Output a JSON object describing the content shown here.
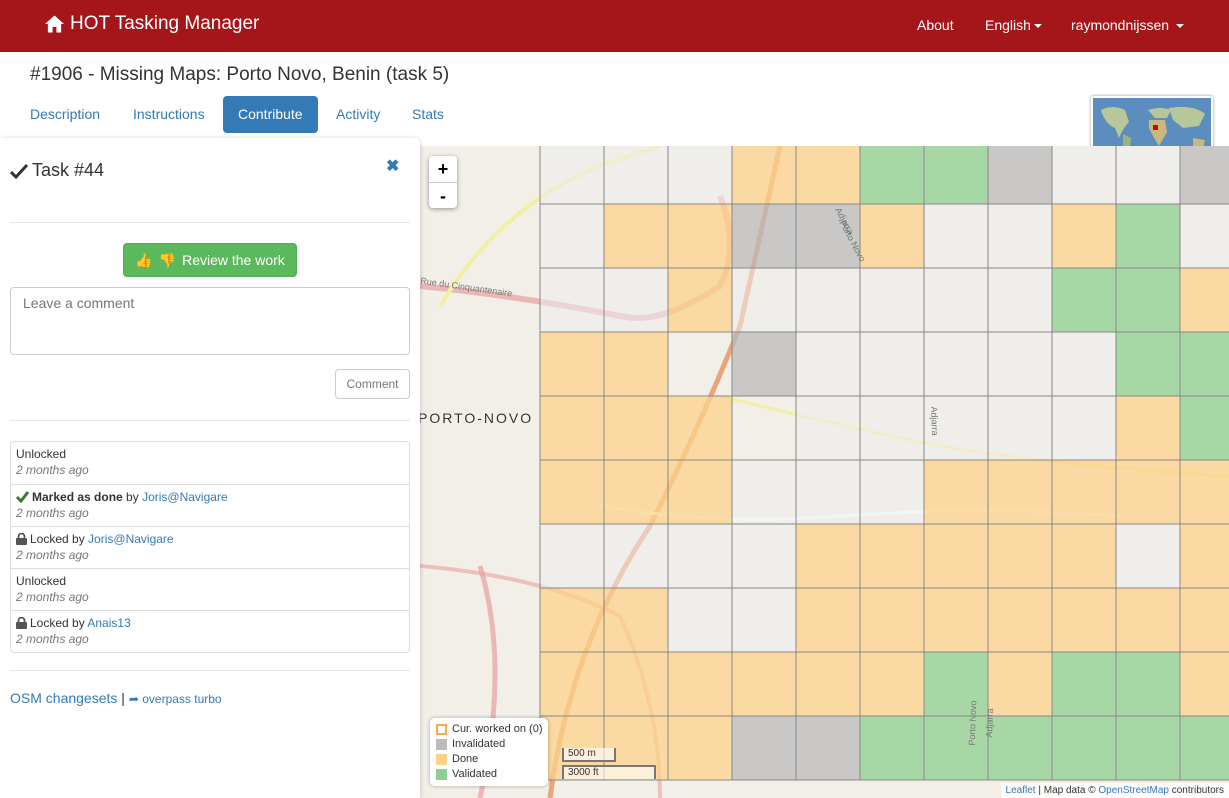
{
  "navbar": {
    "brand": "HOT Tasking Manager",
    "about": "About",
    "language": "English",
    "user": "raymondnijssen"
  },
  "project": {
    "title": "#1906 - Missing Maps: Porto Novo, Benin (task 5)"
  },
  "tabs": [
    "Description",
    "Instructions",
    "Contribute",
    "Activity",
    "Stats"
  ],
  "active_tab": "Contribute",
  "task": {
    "title": "Task #44",
    "review_label": "Review the work",
    "comment_placeholder": "Leave a comment",
    "comment_button": "Comment",
    "history": [
      {
        "action": "Unlocked",
        "time": "2 months ago"
      },
      {
        "action": "Marked as done",
        "by": "by",
        "user": "Joris@Navigare",
        "time": "2 months ago",
        "icon": "check-icon"
      },
      {
        "action": "Locked by",
        "user": "Joris@Navigare",
        "time": "2 months ago",
        "icon": "lock-icon"
      },
      {
        "action": "Unlocked",
        "time": "2 months ago"
      },
      {
        "action": "Locked by",
        "user": "Anais13",
        "time": "2 months ago",
        "icon": "lock-icon"
      }
    ],
    "links": {
      "osm": "OSM changesets",
      "separator": "|",
      "overpass": "overpass turbo"
    }
  },
  "map": {
    "zoom_in": "+",
    "zoom_out": "-",
    "city_label": "PORTO-NOVO",
    "streets": [
      "Adjarra",
      "Porto Novo",
      "Rue du Cinquantenaire",
      "Adjarra",
      "Porto Novo",
      "Adjarra"
    ],
    "legend": [
      {
        "label": "Cur. worked on (0)",
        "color": "#ffffff",
        "border": "#f0ad4e"
      },
      {
        "label": "Invalidated",
        "color": "#bbbbbb"
      },
      {
        "label": "Done",
        "color": "#fcd18a"
      },
      {
        "label": "Validated",
        "color": "#8fcf8f"
      }
    ],
    "scale_m": "500 m",
    "scale_ft": "3000 ft",
    "attribution": {
      "leaflet": "Leaflet",
      "text": " | Map data © ",
      "osm": "OpenStreetMap",
      "tail": " contributors"
    }
  },
  "colors": {
    "navbar": "#a5161a",
    "primary": "#337ab7",
    "success": "#5cb85c",
    "done": "#fcd18a",
    "validated": "#8fcf8f",
    "invalidated": "#bbbbbb",
    "ready": "#ececec"
  },
  "grid": [
    "eeeddvvieeie",
    "eddiideedvee",
    "eedeeeeevvd",
    "dd.ieeeeevvdd",
    "ddd.eeeeedvdd",
    "dddeeedddddd",
    "eeeedddddedv",
    "ddeedddddddv",
    "ddddddvdvvdv",
    "dddiivvvvvvv"
  ]
}
